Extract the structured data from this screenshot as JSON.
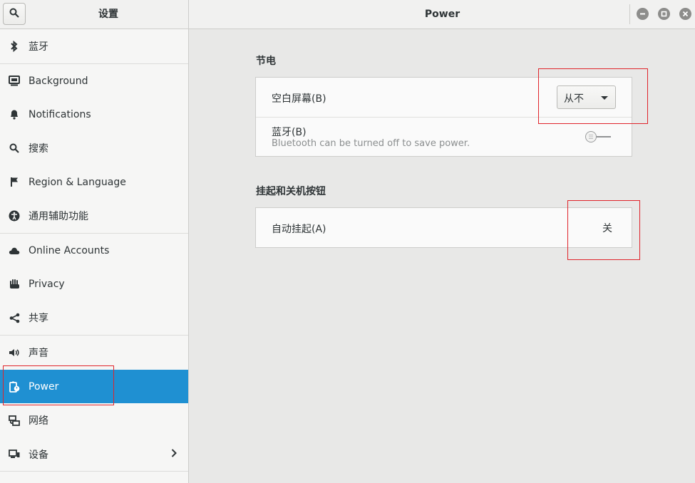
{
  "header": {
    "left_title": "设置",
    "main_title": "Power"
  },
  "sidebar": {
    "items": [
      {
        "label": "蓝牙",
        "icon": "bluetooth-icon"
      },
      {
        "label": "Background",
        "icon": "display-icon"
      },
      {
        "label": "Notifications",
        "icon": "bell-icon"
      },
      {
        "label": "搜索",
        "icon": "search-icon"
      },
      {
        "label": "Region & Language",
        "icon": "flag-icon"
      },
      {
        "label": "通用辅助功能",
        "icon": "accessibility-icon"
      },
      {
        "label": "Online Accounts",
        "icon": "cloud-icon"
      },
      {
        "label": "Privacy",
        "icon": "hand-icon"
      },
      {
        "label": "共享",
        "icon": "share-icon"
      },
      {
        "label": "声音",
        "icon": "speaker-icon"
      },
      {
        "label": "Power",
        "icon": "power-icon",
        "active": true
      },
      {
        "label": "网络",
        "icon": "network-icon"
      },
      {
        "label": "设备",
        "icon": "devices-icon"
      }
    ]
  },
  "main": {
    "power_saving": {
      "title": "节电",
      "blank_screen": {
        "label": "空白屏幕(B)",
        "value": "从不"
      },
      "bluetooth": {
        "label": "蓝牙(B)",
        "description": "Bluetooth can be turned off to save power.",
        "enabled": false
      }
    },
    "suspend": {
      "title": "挂起和关机按钮",
      "auto_suspend": {
        "label": "自动挂起(A)",
        "value": "关"
      }
    }
  },
  "colors": {
    "accent": "#1f90d2",
    "highlight": "#e0242b"
  }
}
